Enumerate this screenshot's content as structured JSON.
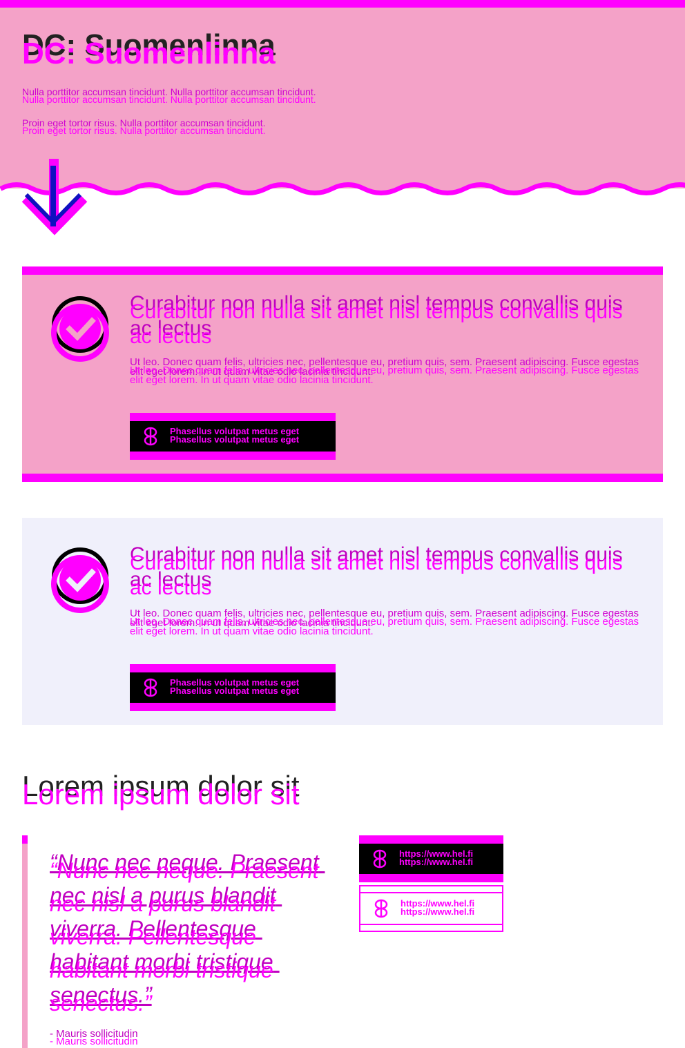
{
  "hero": {
    "title": "DC: Suomenlinna",
    "paragraph_1": "Nulla porttitor accumsan tincidunt. Nulla porttitor accumsan tincidunt.",
    "paragraph_2": "Proin eget tortor risus. Nulla porttitor accumsan tincidunt."
  },
  "cards": [
    {
      "heading": "Curabitur non nulla sit amet nisl tempus convallis quis ac lectus",
      "body": "Ut leo. Donec quam felis, ultricies nec, pellentesque eu, pretium quis, sem. Praesent adipiscing. Fusce egestas elit eget lorem. In ut quam vitae odio lacinia tincidunt.",
      "button_label": "Phasellus volutpat metus eget"
    },
    {
      "heading": "Curabitur non nulla sit amet nisl tempus convallis quis ac lectus",
      "body": "Ut leo. Donec quam felis, ultricies nec, pellentesque eu, pretium quis, sem. Praesent adipiscing. Fusce egestas elit eget lorem. In ut quam vitae odio lacinia tincidunt.",
      "button_label": "Phasellus volutpat metus eget"
    }
  ],
  "section": {
    "title": "Lorem ipsum dolor sit",
    "quote": "“Nunc nec neque. Praesent nec nisl a purus blandit viverra. Pellentesque habitant morbi tristique senectus.”",
    "quote_author": "- Mauris sollicitudin",
    "links": [
      {
        "label": "https://www.hel.fi",
        "style": "filled"
      },
      {
        "label": "https://www.hel.fi",
        "style": "outline"
      }
    ]
  },
  "colors": {
    "accent": "#ff00ff",
    "hero_bg": "#f4a2c8",
    "lavender_bg": "#f0f0fb"
  },
  "icons": {
    "card_icon": "check-circle-icon",
    "button_icon": "helsinki-logo-icon",
    "scroll_icon": "arrow-down-icon"
  }
}
